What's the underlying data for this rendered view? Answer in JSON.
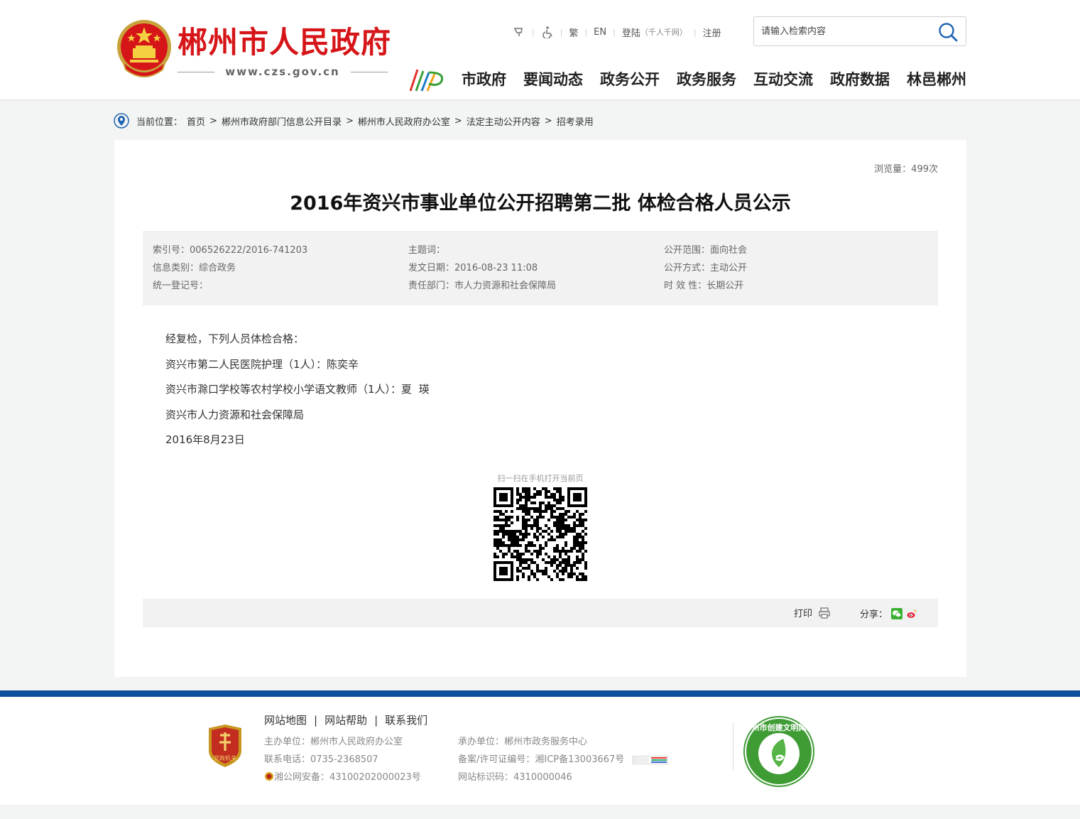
{
  "header": {
    "site_name": "郴州市人民政府",
    "site_url": "www.czs.gov.cn",
    "toplinks": {
      "trad": "繁",
      "en": "EN",
      "login": "登陆",
      "login_note": "（千人千网）",
      "register": "注册"
    },
    "search_placeholder": "请输入检索内容",
    "nav": [
      "市政府",
      "要闻动态",
      "政务公开",
      "政务服务",
      "互动交流",
      "政府数据",
      "林邑郴州"
    ]
  },
  "breadcrumb": {
    "label": "当前位置：",
    "items": [
      "首页",
      "郴州市政府部门信息公开目录",
      "郴州市人民政府办公室",
      "法定主动公开内容",
      "招考录用"
    ]
  },
  "article": {
    "views": "浏览量：499次",
    "title": "2016年资兴市事业单位公开招聘第二批 体检合格人员公示",
    "meta": {
      "index_no": "索引号：006526222/2016-741203",
      "category": "信息类别：综合政务",
      "reg_no": "统一登记号：",
      "keywords": "主题词：",
      "date": "发文日期：2016-08-23 11:08",
      "dept": "责任部门：市人力资源和社会保障局",
      "scope": "公开范围：面向社会",
      "mode": "公开方式：主动公开",
      "validity": "时 效 性：长期公开"
    },
    "paragraphs": [
      "经复检，下列人员体检合格：",
      "资兴市第二人民医院护理（1人）：陈奕辛",
      "资兴市滁口学校等农村学校小学语文教师（1人）：夏  瑛",
      "资兴市人力资源和社会保障局",
      "2016年8月23日"
    ],
    "qr_label": "扫一扫在手机打开当前页",
    "print_label": "打印",
    "share_label": "分享："
  },
  "footer": {
    "links": [
      "网站地图",
      "网站帮助",
      "联系我们"
    ],
    "sponsor": "主办单位：郴州市人民政府办公室",
    "phone": "联系电话：0735-2368507",
    "police": "湘公网安备：43100202000023号",
    "undertaker": "承办单位：郴州市政务服务中心",
    "icp": "备案/许可证编号：湘ICP备13003667号",
    "site_id": "网站标识码：4310000046",
    "dang_text": "党政机关",
    "civil_text": "郴州市创建文明网站"
  },
  "colors": {
    "brand_red": "#d61518",
    "footer_blue": "#0c4f9b"
  }
}
